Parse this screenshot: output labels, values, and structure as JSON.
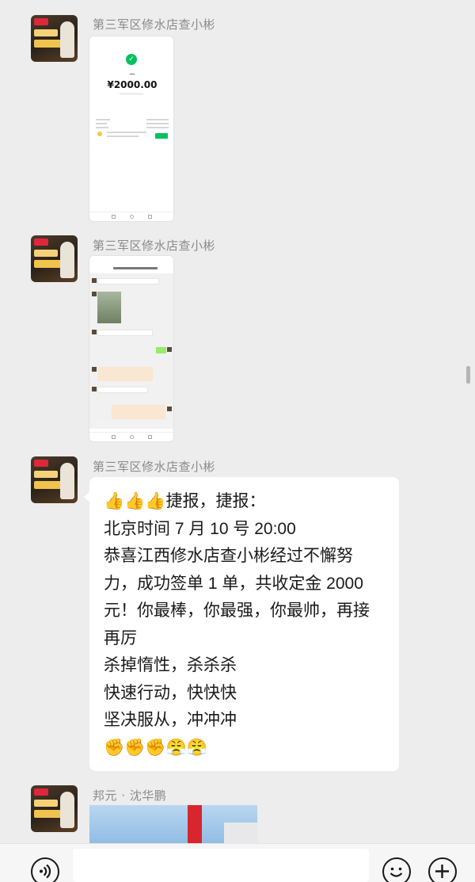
{
  "messages": [
    {
      "sender": "第三军区修水店查小彬",
      "type": "screenshot"
    },
    {
      "sender": "第三军区修水店查小彬",
      "type": "screenshot"
    },
    {
      "sender": "第三军区修水店查小彬",
      "type": "text"
    },
    {
      "sender": "邦元 · 沈华鹏",
      "type": "photo"
    }
  ],
  "payment": {
    "amount": "¥2000.00"
  },
  "announcement": {
    "lines": [
      "👍👍👍捷报，捷报：",
      "北京时间 7 月 10 号 20:00",
      "恭喜江西修水店查小彬经过不懈努",
      "力，成功签单 1 单，共收定金 2000",
      "元！你最棒，你最强，你最帅，再接",
      "再厉",
      "杀掉惰性，杀杀杀",
      "快速行动，快快快",
      "坚决服从，冲冲冲",
      "✊✊✊😤😤"
    ]
  },
  "input_bar": {
    "voice_icon": "voice-icon",
    "emoji_icon": "emoji-icon",
    "plus_icon": "plus-icon"
  },
  "colors": {
    "background": "#ededed",
    "wechat_green": "#07c160",
    "bubble": "#ffffff"
  }
}
